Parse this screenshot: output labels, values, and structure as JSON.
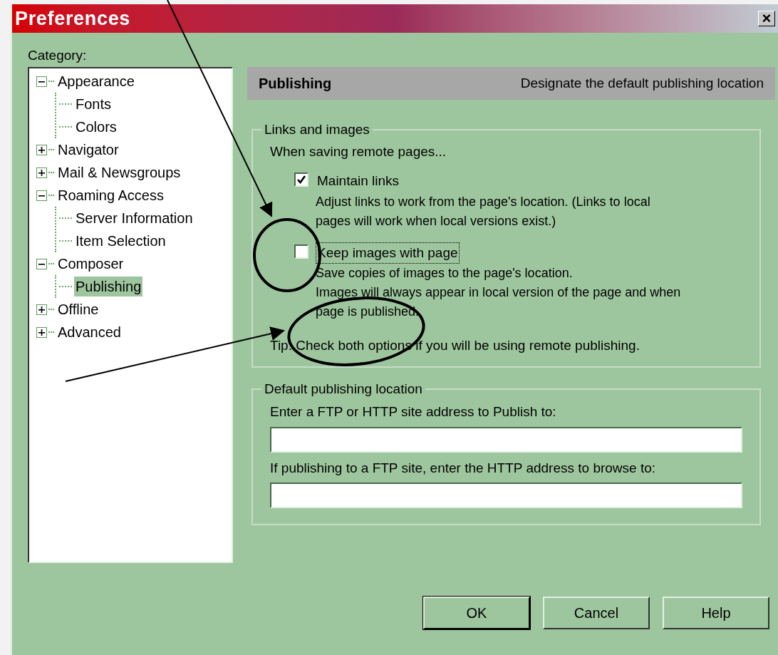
{
  "window": {
    "title": "Preferences",
    "close": "×"
  },
  "category_label": "Category:",
  "tree": [
    {
      "label": "Appearance",
      "kind": "branch",
      "expanded": true,
      "selected": false,
      "children": [
        {
          "label": "Fonts",
          "kind": "leaf",
          "selected": false
        },
        {
          "label": "Colors",
          "kind": "leaf",
          "selected": false
        }
      ]
    },
    {
      "label": "Navigator",
      "kind": "branch",
      "expanded": false,
      "selected": false
    },
    {
      "label": "Mail & Newsgroups",
      "kind": "branch",
      "expanded": false,
      "selected": false
    },
    {
      "label": "Roaming Access",
      "kind": "branch",
      "expanded": true,
      "selected": false,
      "children": [
        {
          "label": "Server Information",
          "kind": "leaf",
          "selected": false
        },
        {
          "label": "Item Selection",
          "kind": "leaf",
          "selected": false
        }
      ]
    },
    {
      "label": "Composer",
      "kind": "branch",
      "expanded": true,
      "selected": false,
      "children": [
        {
          "label": "Publishing",
          "kind": "leaf",
          "selected": true
        }
      ]
    },
    {
      "label": "Offline",
      "kind": "branch",
      "expanded": false,
      "selected": false
    },
    {
      "label": "Advanced",
      "kind": "branch",
      "expanded": false,
      "selected": false
    }
  ],
  "header": {
    "title": "Publishing",
    "description": "Designate the default publishing location"
  },
  "links_group": {
    "legend": "Links and images",
    "intro": "When saving remote pages...",
    "options": [
      {
        "label": "Maintain links",
        "checked": true,
        "focused": false,
        "description": [
          "Adjust links to work from the page's location. (Links to local",
          "pages will work when local versions exist.)"
        ]
      },
      {
        "label": "Keep images with page",
        "checked": false,
        "focused": true,
        "description": [
          "Save copies of images to the page's location.",
          "Images will always appear in local version of the page and when",
          "page is published."
        ]
      }
    ],
    "tip": "Tip: Check both options if you will be using remote publishing."
  },
  "location_group": {
    "legend": "Default publishing location",
    "fields": [
      {
        "label": "Enter a FTP or HTTP site address to Publish to:"
      },
      {
        "label": "If publishing to a FTP site, enter the HTTP address to browse to:"
      }
    ]
  },
  "buttons": [
    {
      "label": "OK",
      "default": true
    },
    {
      "label": "Cancel",
      "default": false
    },
    {
      "label": "Help",
      "default": false
    }
  ]
}
